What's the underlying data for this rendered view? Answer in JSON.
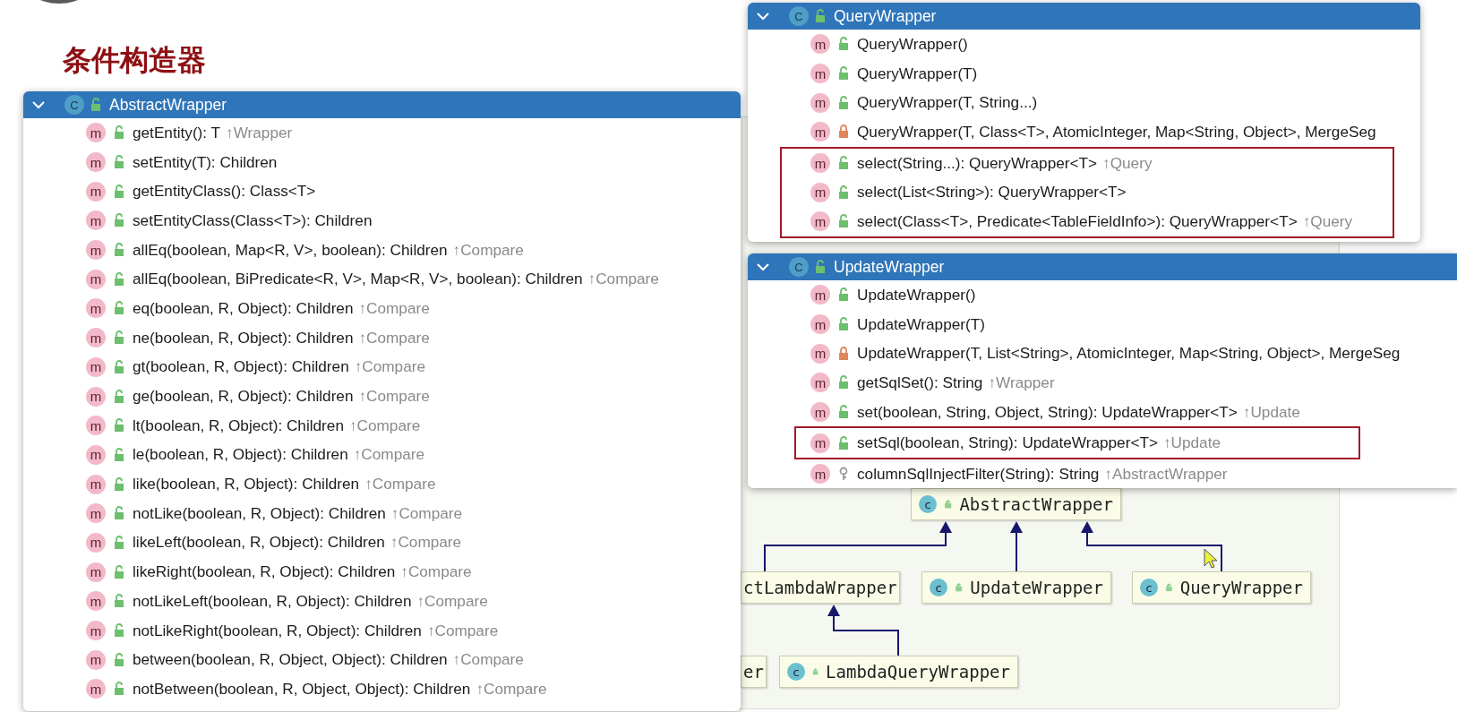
{
  "title": "条件构造器",
  "diagram": {
    "nodes": [
      {
        "label": "AbstractWrapper",
        "icon_letter": "c"
      },
      {
        "label": "ctLambdaWrapper"
      },
      {
        "label": "UpdateWrapper",
        "icon_letter": "c"
      },
      {
        "label": "QueryWrapper",
        "icon_letter": "c"
      },
      {
        "label": "er"
      },
      {
        "label": "LambdaQueryWrapper",
        "icon_letter": "c"
      }
    ]
  },
  "popups": [
    {
      "class_name": "AbstractWrapper",
      "icon_letter": "C",
      "expanded": true,
      "members": [
        {
          "icon_letter": "m",
          "kind": "public",
          "signature": "getEntity(): T",
          "origin": "↑Wrapper",
          "highlighted": false
        },
        {
          "icon_letter": "m",
          "kind": "public",
          "signature": "setEntity(T): Children",
          "highlighted": false
        },
        {
          "icon_letter": "m",
          "kind": "public",
          "signature": "getEntityClass(): Class<T>",
          "highlighted": false
        },
        {
          "icon_letter": "m",
          "kind": "public",
          "signature": "setEntityClass(Class<T>): Children",
          "highlighted": false
        },
        {
          "icon_letter": "m",
          "kind": "public",
          "signature": "allEq(boolean, Map<R, V>, boolean): Children",
          "origin": "↑Compare",
          "highlighted": false
        },
        {
          "icon_letter": "m",
          "kind": "public",
          "signature": "allEq(boolean, BiPredicate<R, V>, Map<R, V>, boolean): Children",
          "origin": "↑Compare",
          "highlighted": false
        },
        {
          "icon_letter": "m",
          "kind": "public",
          "signature": "eq(boolean, R, Object): Children",
          "origin": "↑Compare",
          "highlighted": false
        },
        {
          "icon_letter": "m",
          "kind": "public",
          "signature": "ne(boolean, R, Object): Children",
          "origin": "↑Compare",
          "highlighted": false
        },
        {
          "icon_letter": "m",
          "kind": "public",
          "signature": "gt(boolean, R, Object): Children",
          "origin": "↑Compare",
          "highlighted": false
        },
        {
          "icon_letter": "m",
          "kind": "public",
          "signature": "ge(boolean, R, Object): Children",
          "origin": "↑Compare",
          "highlighted": false
        },
        {
          "icon_letter": "m",
          "kind": "public",
          "signature": "lt(boolean, R, Object): Children",
          "origin": "↑Compare",
          "highlighted": false
        },
        {
          "icon_letter": "m",
          "kind": "public",
          "signature": "le(boolean, R, Object): Children",
          "origin": "↑Compare",
          "highlighted": false
        },
        {
          "icon_letter": "m",
          "kind": "public",
          "signature": "like(boolean, R, Object): Children",
          "origin": "↑Compare",
          "highlighted": false
        },
        {
          "icon_letter": "m",
          "kind": "public",
          "signature": "notLike(boolean, R, Object): Children",
          "origin": "↑Compare",
          "highlighted": false
        },
        {
          "icon_letter": "m",
          "kind": "public",
          "signature": "likeLeft(boolean, R, Object): Children",
          "origin": "↑Compare",
          "highlighted": false
        },
        {
          "icon_letter": "m",
          "kind": "public",
          "signature": "likeRight(boolean, R, Object): Children",
          "origin": "↑Compare",
          "highlighted": false
        },
        {
          "icon_letter": "m",
          "kind": "public",
          "signature": "notLikeLeft(boolean, R, Object): Children",
          "origin": "↑Compare",
          "highlighted": false
        },
        {
          "icon_letter": "m",
          "kind": "public",
          "signature": "notLikeRight(boolean, R, Object): Children",
          "origin": "↑Compare",
          "highlighted": false
        },
        {
          "icon_letter": "m",
          "kind": "public",
          "signature": "between(boolean, R, Object, Object): Children",
          "origin": "↑Compare",
          "highlighted": false
        },
        {
          "icon_letter": "m",
          "kind": "public",
          "signature": "notBetween(boolean, R, Object, Object): Children",
          "origin": "↑Compare",
          "highlighted": false
        }
      ]
    },
    {
      "class_name": "QueryWrapper",
      "icon_letter": "C",
      "expanded": true,
      "members": [
        {
          "icon_letter": "m",
          "kind": "public",
          "signature": "QueryWrapper()",
          "highlighted": false
        },
        {
          "icon_letter": "m",
          "kind": "public",
          "signature": "QueryWrapper(T)",
          "highlighted": false
        },
        {
          "icon_letter": "m",
          "kind": "public",
          "signature": "QueryWrapper(T, String...)",
          "highlighted": false
        },
        {
          "icon_letter": "m",
          "kind": "private",
          "signature": "QueryWrapper(T, Class<T>, AtomicInteger, Map<String, Object>, MergeSeg",
          "highlighted": false
        },
        {
          "icon_letter": "m",
          "kind": "public",
          "signature": "select(String...): QueryWrapper<T>",
          "origin": "↑Query",
          "highlighted": true
        },
        {
          "icon_letter": "m",
          "kind": "public",
          "signature": "select(List<String>): QueryWrapper<T>",
          "highlighted": true
        },
        {
          "icon_letter": "m",
          "kind": "public",
          "signature": "select(Class<T>, Predicate<TableFieldInfo>): QueryWrapper<T>",
          "origin": "↑Query",
          "highlighted": true
        }
      ]
    },
    {
      "class_name": "UpdateWrapper",
      "icon_letter": "C",
      "expanded": true,
      "members": [
        {
          "icon_letter": "m",
          "kind": "public",
          "signature": "UpdateWrapper()",
          "highlighted": false
        },
        {
          "icon_letter": "m",
          "kind": "public",
          "signature": "UpdateWrapper(T)",
          "highlighted": false
        },
        {
          "icon_letter": "m",
          "kind": "private",
          "signature": "UpdateWrapper(T, List<String>, AtomicInteger, Map<String, Object>, MergeSeg",
          "highlighted": false
        },
        {
          "icon_letter": "m",
          "kind": "public",
          "signature": "getSqlSet(): String",
          "origin": "↑Wrapper",
          "highlighted": false
        },
        {
          "icon_letter": "m",
          "kind": "public",
          "signature": "set(boolean, String, Object, String): UpdateWrapper<T>",
          "origin": "↑Update",
          "highlighted": false
        },
        {
          "icon_letter": "m",
          "kind": "public",
          "signature": "setSql(boolean, String): UpdateWrapper<T>",
          "origin": "↑Update",
          "highlighted": true
        },
        {
          "icon_letter": "m",
          "kind": "protected",
          "signature": "columnSqlInjectFilter(String): String",
          "origin": "↑AbstractWrapper",
          "highlighted": false
        }
      ]
    }
  ]
}
